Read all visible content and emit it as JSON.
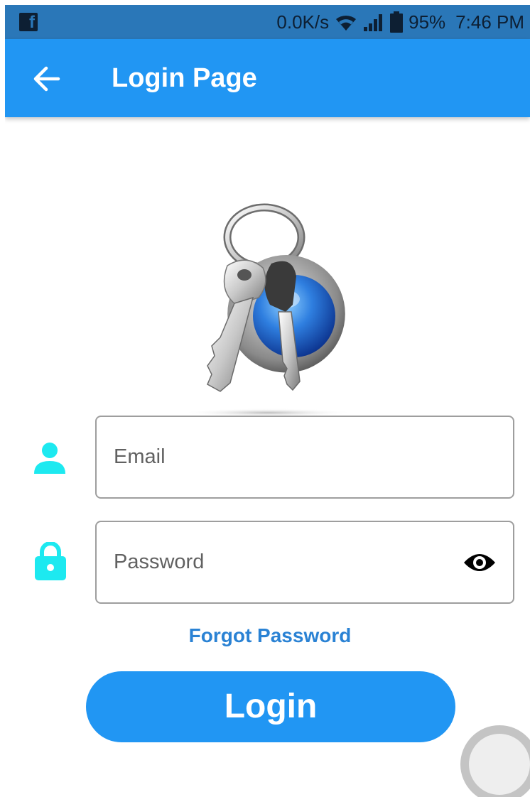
{
  "status_bar": {
    "app_icon": "facebook-icon",
    "net_speed": "0.0K/s",
    "icons": [
      "wifi-icon",
      "signal-icon",
      "battery-icon"
    ],
    "battery": "95%",
    "time": "7:46 PM"
  },
  "app_bar": {
    "back_icon": "arrow-back-icon",
    "title": "Login Page"
  },
  "logo": {
    "icon": "keychain-icon"
  },
  "email": {
    "icon": "person-icon",
    "placeholder": "Email",
    "value": ""
  },
  "password": {
    "icon": "lock-icon",
    "placeholder": "Password",
    "value": "",
    "toggle_icon": "eye-icon"
  },
  "forgot_label": "Forgot Password",
  "login_label": "Login",
  "colors": {
    "primary": "#2196f3",
    "status_bar": "#2a77b8",
    "field_icon": "#1de9f0",
    "link": "#2a82d4"
  }
}
